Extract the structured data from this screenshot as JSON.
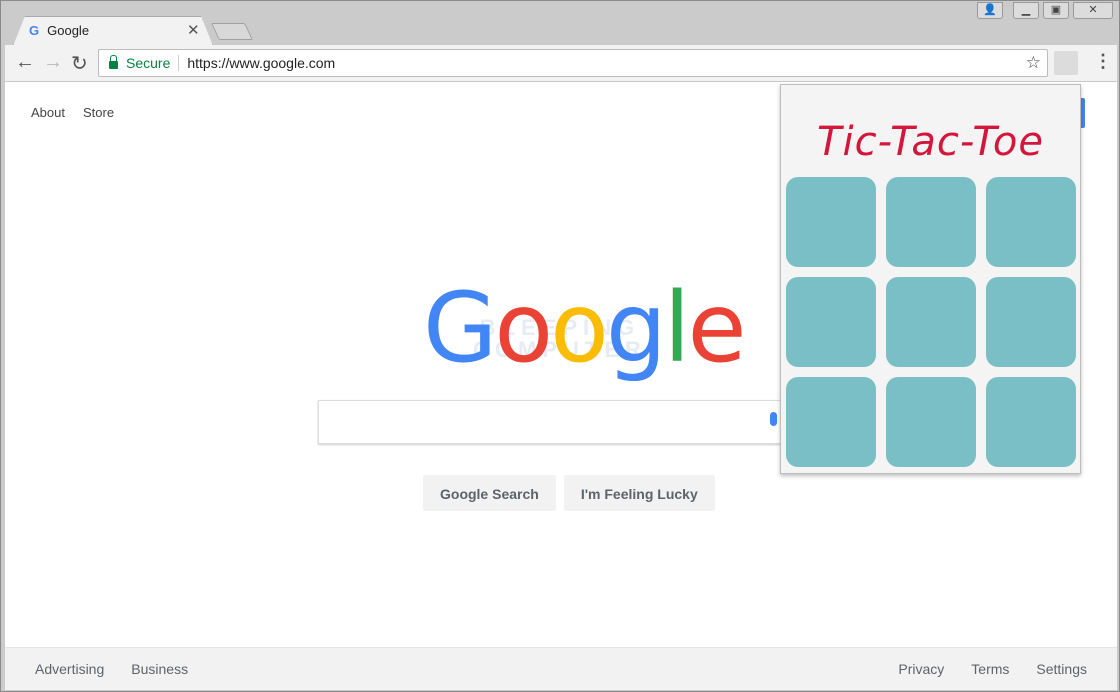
{
  "browser": {
    "tab_title": "Google",
    "url": "https://www.google.com",
    "secure_label": "Secure",
    "icons": [
      "back-icon",
      "forward-icon",
      "reload-icon",
      "lock-icon",
      "star-icon",
      "extension-icon",
      "menu-icon",
      "profile-icon",
      "minimize-icon",
      "restore-icon",
      "close-icon"
    ]
  },
  "page": {
    "top_links": [
      "About",
      "Store"
    ],
    "logo": "Google",
    "search_placeholder": "",
    "watermark": "BLEEPING COMPUTER",
    "buttons": {
      "search": "Google Search",
      "lucky": "I'm Feeling Lucky"
    },
    "footer_left": [
      "Advertising",
      "Business"
    ],
    "footer_right": [
      "Privacy",
      "Terms",
      "Settings"
    ]
  },
  "popup": {
    "title": "Tic-Tac-Toe",
    "cells": [
      "",
      "",
      "",
      "",
      "",
      "",
      "",
      "",
      ""
    ],
    "colors": {
      "title": "#d4163c",
      "cell": "#7abfc5"
    }
  }
}
